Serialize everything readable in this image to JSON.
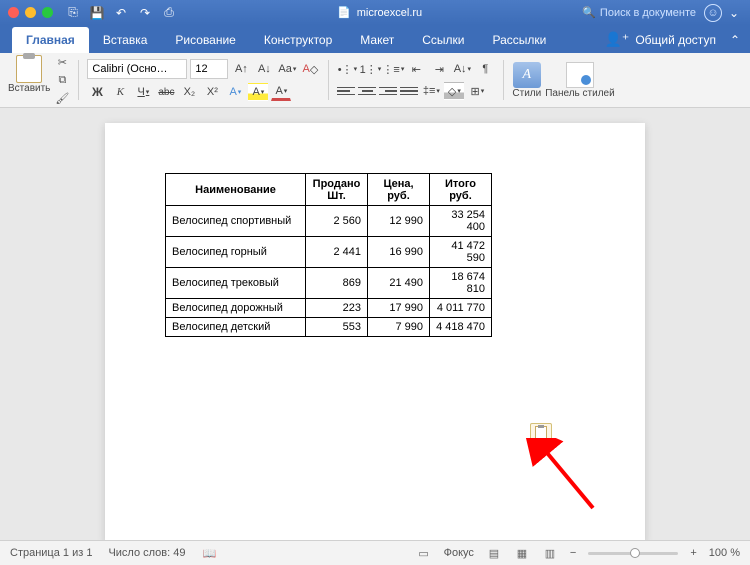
{
  "titlebar": {
    "doc_name": "microexcel.ru",
    "search_placeholder": "Поиск в документе"
  },
  "tabs": {
    "items": [
      "Главная",
      "Вставка",
      "Рисование",
      "Конструктор",
      "Макет",
      "Ссылки",
      "Рассылки"
    ],
    "active_index": 0,
    "share_label": "Общий доступ"
  },
  "ribbon": {
    "paste_label": "Вставить",
    "font_name": "Calibri (Осно…",
    "font_size": "12",
    "styles_label": "Стили",
    "panel_label": "Панель стилей"
  },
  "table": {
    "headers": [
      "Наименование",
      "Продано Шт.",
      "Цена, руб.",
      "Итого руб."
    ],
    "rows": [
      [
        "Велосипед спортивный",
        "2 560",
        "12 990",
        "33 254 400"
      ],
      [
        "Велосипед горный",
        "2 441",
        "16 990",
        "41 472 590"
      ],
      [
        "Велосипед трековый",
        "869",
        "21 490",
        "18 674 810"
      ],
      [
        "Велосипед дорожный",
        "223",
        "17 990",
        "4 011 770"
      ],
      [
        "Велосипед детский",
        "553",
        "7 990",
        "4 418 470"
      ]
    ]
  },
  "statusbar": {
    "page_info": "Страница 1 из 1",
    "word_count": "Число слов: 49",
    "focus_label": "Фокус",
    "zoom_level": "100 %"
  }
}
